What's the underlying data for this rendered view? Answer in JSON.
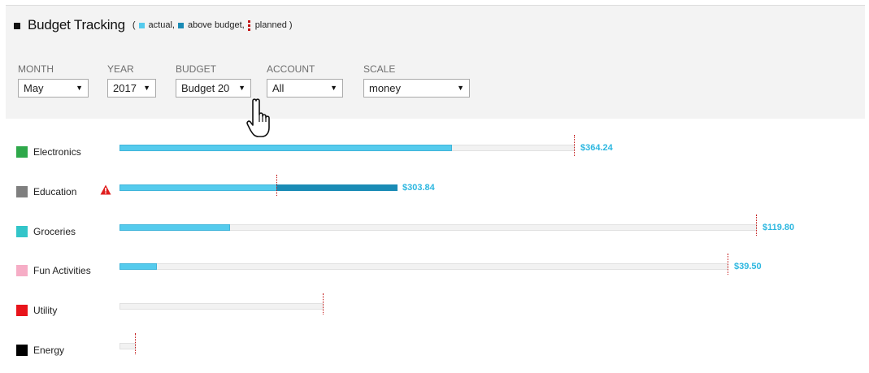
{
  "header": {
    "title": "Budget Tracking",
    "legend": {
      "open": "(",
      "actual": "actual,",
      "above": "above budget,",
      "planned": "planned )"
    }
  },
  "filters": [
    {
      "label": "MONTH",
      "value": "May"
    },
    {
      "label": "YEAR",
      "value": "2017"
    },
    {
      "label": "BUDGET",
      "value": "Budget 20"
    },
    {
      "label": "ACCOUNT",
      "value": "All"
    },
    {
      "label": "SCALE",
      "value": "money"
    }
  ],
  "colors": {
    "actual": "#55cbed",
    "above_budget": "#1a8bb5",
    "planned": "#c21414",
    "track": "#f2f2f2",
    "value_text": "#2db7e0"
  },
  "categories": [
    {
      "name": "Electronics",
      "color": "#2ea84a",
      "value_label": "$364.24",
      "warning": false
    },
    {
      "name": "Education",
      "color": "#7f7f7f",
      "value_label": "$303.84",
      "warning": true
    },
    {
      "name": "Groceries",
      "color": "#33c5c9",
      "value_label": "$119.80",
      "warning": false
    },
    {
      "name": "Fun Activities",
      "color": "#f6adc6",
      "value_label": "$39.50",
      "warning": false
    },
    {
      "name": "Utility",
      "color": "#e8141b",
      "value_label": "",
      "warning": false
    },
    {
      "name": "Energy",
      "color": "#000000",
      "value_label": "",
      "warning": false
    }
  ],
  "icons": {
    "title_marker": "square-icon",
    "warning": "warning-triangle-icon",
    "cursor": "hand-pointer-icon",
    "dropdown": "caret-down-icon"
  }
}
